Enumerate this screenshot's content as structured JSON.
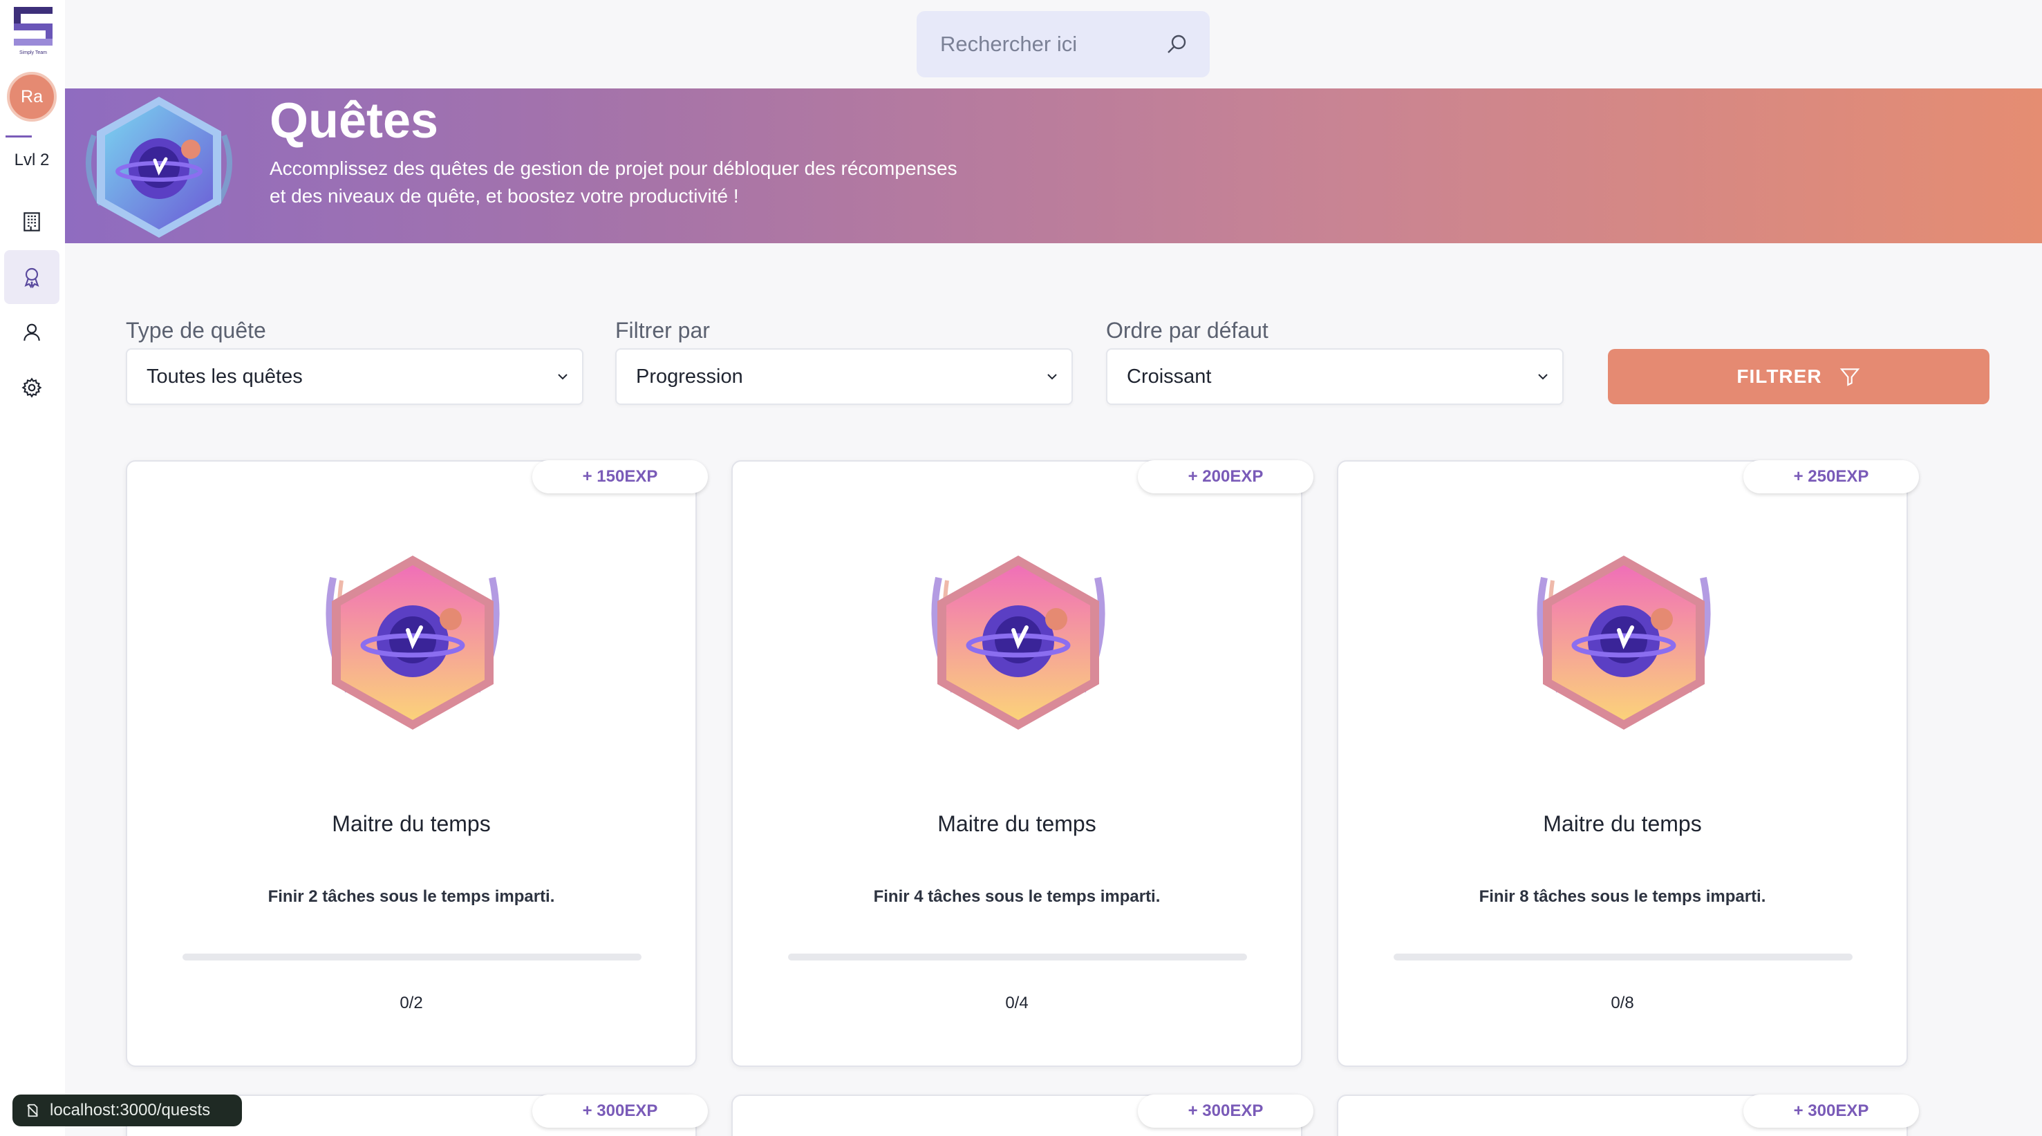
{
  "app": {
    "brand_icon": "simply-team-logo",
    "brand_caption": "Simply Team"
  },
  "user": {
    "initials": "Ra",
    "level": "Lvl 2",
    "avatar_color": "#e58a72"
  },
  "nav": [
    {
      "name": "building-icon",
      "active": false
    },
    {
      "name": "award-icon",
      "active": true
    },
    {
      "name": "user-icon",
      "active": false
    },
    {
      "name": "settings-icon",
      "active": false
    }
  ],
  "search": {
    "placeholder": "Rechercher ici"
  },
  "banner": {
    "title": "Quêtes",
    "description": "Accomplissez des quêtes de gestion de projet pour débloquer des récompenses et des niveaux de quête, et boostez votre productivité !"
  },
  "filters": {
    "type": {
      "label": "Type de quête",
      "value": "Toutes les quêtes"
    },
    "filter_by": {
      "label": "Filtrer par",
      "value": "Progression"
    },
    "order": {
      "label": "Ordre par défaut",
      "value": "Croissant"
    },
    "button_label": "FILTRER"
  },
  "quests": [
    {
      "exp": "+ 150EXP",
      "title": "Maitre du temps",
      "description": "Finir 2 tâches sous le temps imparti.",
      "count": "0/2",
      "progress": 0
    },
    {
      "exp": "+ 200EXP",
      "title": "Maitre du temps",
      "description": "Finir 4 tâches sous le temps imparti.",
      "count": "0/4",
      "progress": 0
    },
    {
      "exp": "+ 250EXP",
      "title": "Maitre du temps",
      "description": "Finir 8 tâches sous le temps imparti.",
      "count": "0/8",
      "progress": 0
    }
  ],
  "next_quests": [
    {
      "exp": "+ 300EXP"
    },
    {
      "exp": "+ 300EXP"
    },
    {
      "exp": "+ 300EXP"
    }
  ],
  "status_bar": {
    "url": "localhost:3000/quests"
  },
  "colors": {
    "accent": "#7a5bb8",
    "brand_orange": "#e58a72"
  }
}
